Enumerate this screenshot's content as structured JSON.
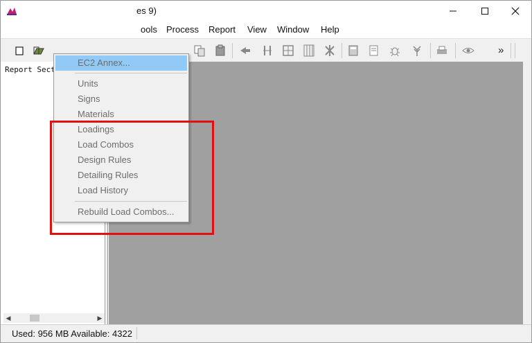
{
  "window": {
    "title": "es 9)",
    "minimize_glyph": "─",
    "maximize_glyph": "☐",
    "close_glyph": "✕"
  },
  "menu": {
    "items": [
      {
        "label": "ools"
      },
      {
        "label": "Process"
      },
      {
        "label": "Report"
      },
      {
        "label": "View"
      },
      {
        "label": "Window"
      },
      {
        "label": "Help"
      }
    ]
  },
  "toolbar": {
    "icons": [
      "open-file-icon",
      "copy-icon",
      "paste-icon",
      "arrow-icon",
      "columns-icon",
      "frame-icon",
      "grid-icon",
      "rebar-icon",
      "calculator-icon",
      "document-icon",
      "bug-icon",
      "tree-icon",
      "print-icon",
      "eye-icon"
    ],
    "overflow_label": "»"
  },
  "left_panel": {
    "report_label": "Report Sect",
    "scroll_left": "◀",
    "scroll_right": "▶"
  },
  "dropdown": {
    "items": [
      {
        "label": "EC2 Annex...",
        "highlighted": true
      },
      {
        "label": "Units"
      },
      {
        "label": "Signs"
      },
      {
        "label": "Materials"
      },
      {
        "label": "Loadings"
      },
      {
        "label": "Load Combos"
      },
      {
        "label": "Design Rules"
      },
      {
        "label": "Detailing Rules"
      },
      {
        "label": "Load History"
      },
      {
        "label": "Rebuild Load Combos..."
      }
    ]
  },
  "status": {
    "text": "Used: 956 MB  Available: 4322"
  },
  "colors": {
    "highlight": "#91c9f7",
    "annotation": "#e01010",
    "workspace": "#a0a0a0"
  }
}
